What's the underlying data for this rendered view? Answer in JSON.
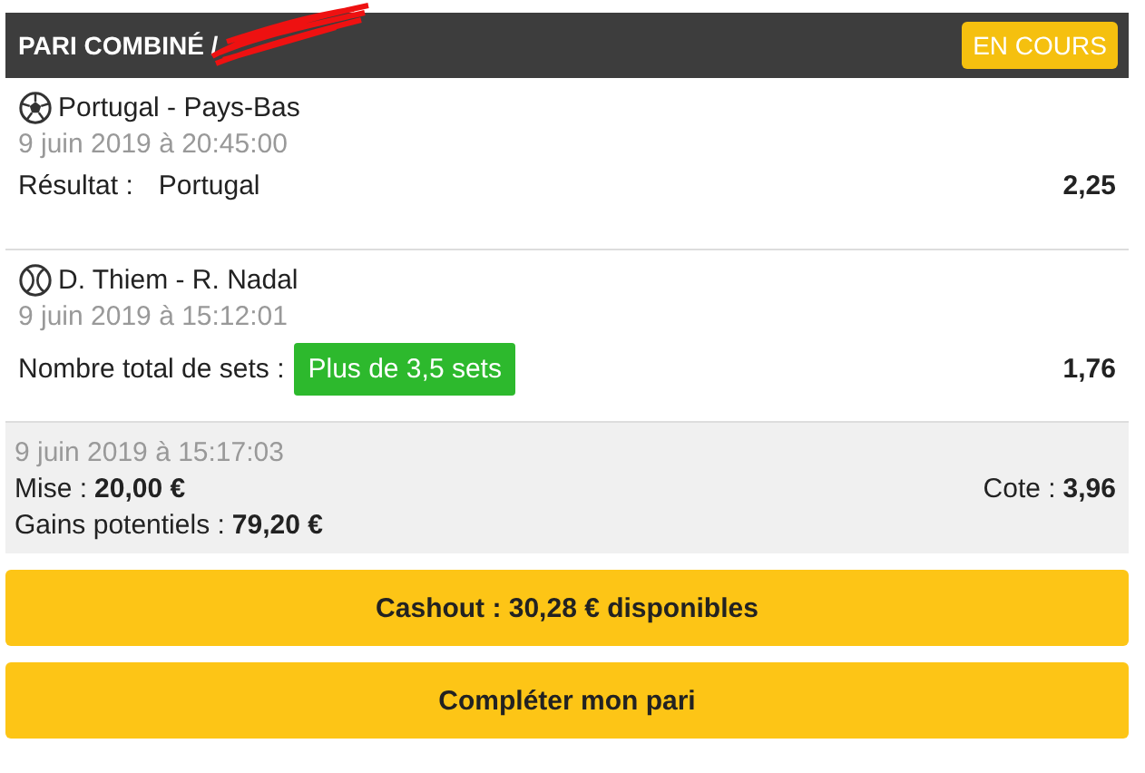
{
  "header": {
    "title": "PARI COMBINÉ /",
    "status": "EN COURS"
  },
  "matches": [
    {
      "kind": "football",
      "name": "Portugal - Pays-Bas",
      "date": "9 juin 2019 à 20:45:00",
      "market": "Résultat :",
      "selection": "Portugal",
      "highlighted": false,
      "odds": "2,25"
    },
    {
      "kind": "tennis",
      "name": "D. Thiem - R. Nadal",
      "date": "9 juin 2019 à 15:12:01",
      "market": "Nombre total de sets :",
      "selection": "Plus de 3,5 sets",
      "highlighted": true,
      "odds": "1,76"
    }
  ],
  "summary": {
    "date": "9 juin 2019 à 15:17:03",
    "stake_label": "Mise  :",
    "stake": "20,00 €",
    "odds_label": "Cote :",
    "odds": "3,96",
    "gains_label": "Gains potentiels  :",
    "gains": "79,20 €"
  },
  "buttons": [
    "Cashout : 30,28 € disponibles",
    "Compléter mon pari"
  ]
}
